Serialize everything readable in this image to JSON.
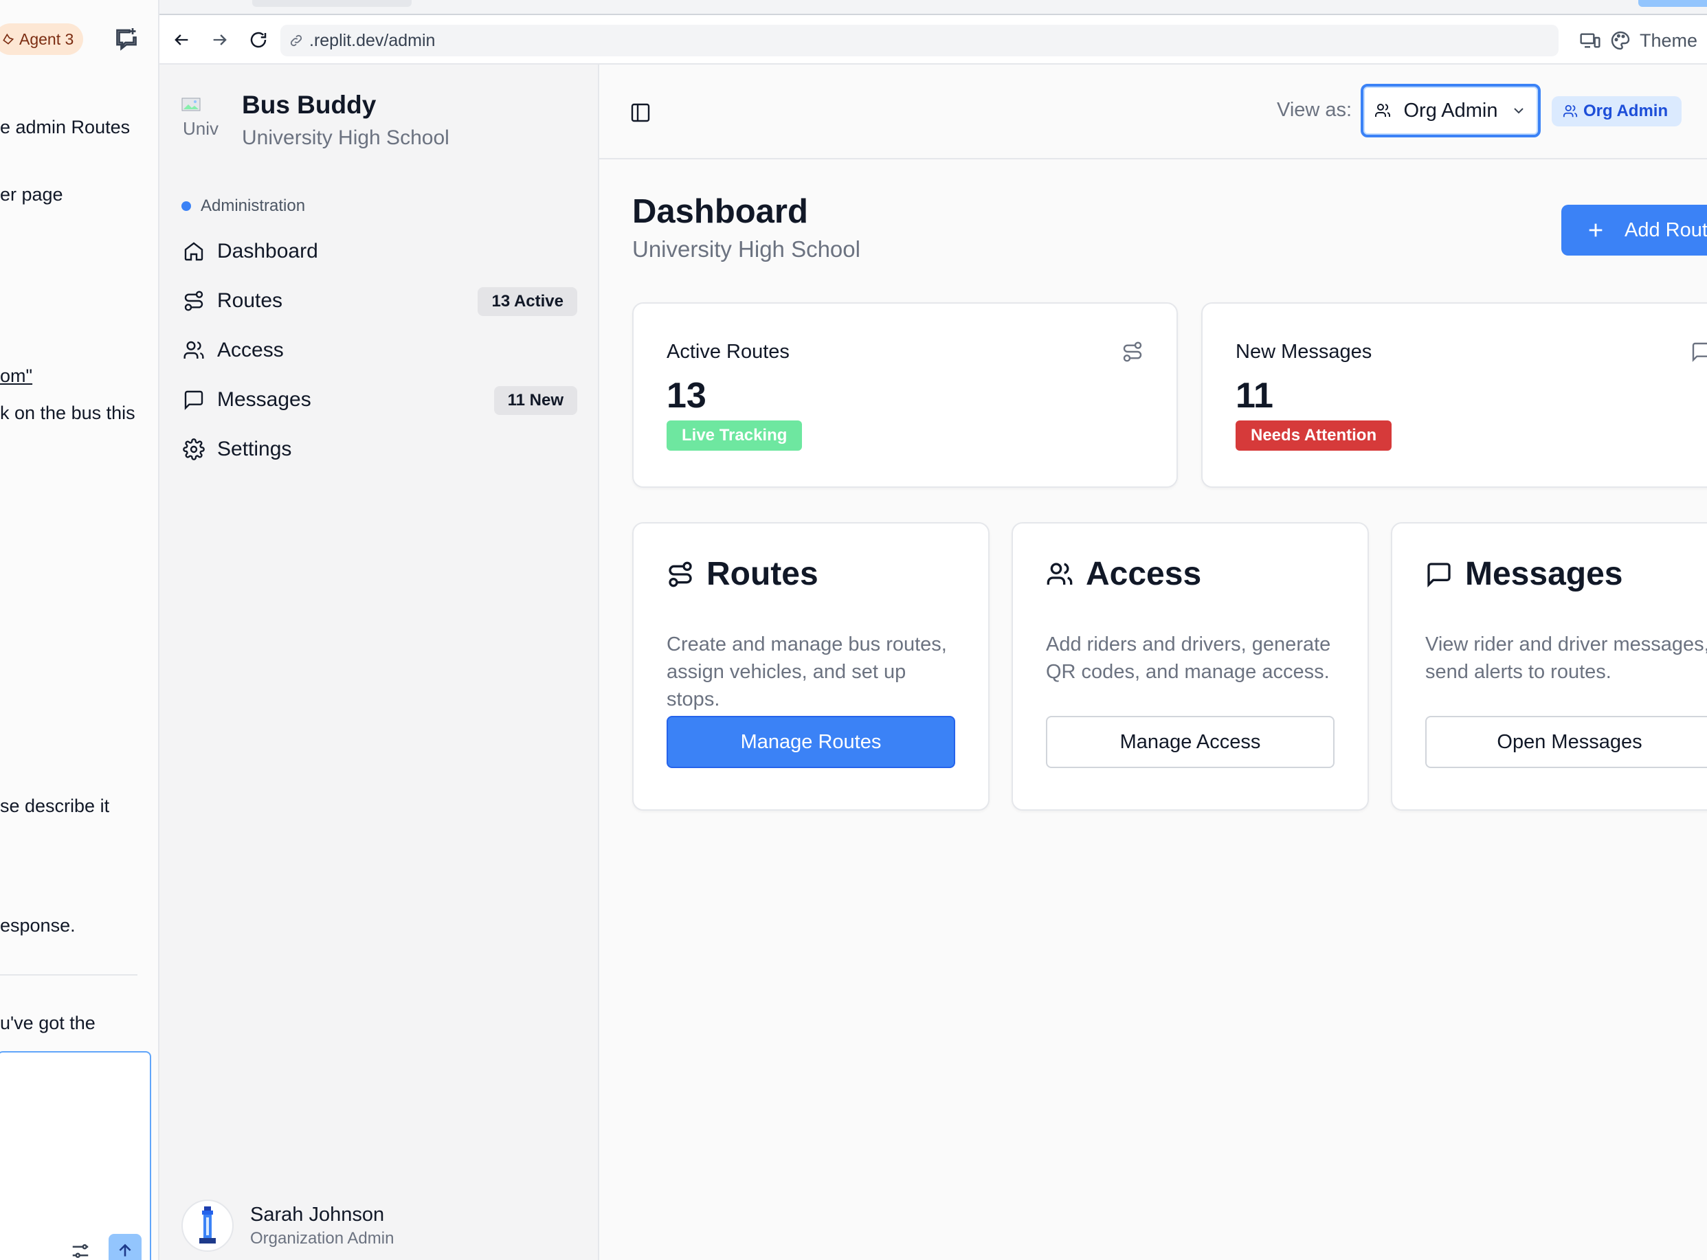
{
  "agent_panel": {
    "badge": "Agent 3",
    "chat_lines": [
      "e admin Routes",
      "er page",
      "om\"",
      "k on the bus this",
      "se describe it",
      "esponse.",
      "u've got the"
    ]
  },
  "browser": {
    "url": ".replit.dev/admin",
    "theme_label": "Theme"
  },
  "sidebar": {
    "app_title": "Bus Buddy",
    "app_subtitle": "University High School",
    "logo_alt": "Univ",
    "section_label": "Administration",
    "items": [
      {
        "label": "Dashboard",
        "icon": "home-icon"
      },
      {
        "label": "Routes",
        "icon": "route-icon",
        "badge": "13 Active"
      },
      {
        "label": "Access",
        "icon": "users-icon"
      },
      {
        "label": "Messages",
        "icon": "message-icon",
        "badge": "11 New"
      },
      {
        "label": "Settings",
        "icon": "gear-icon"
      }
    ],
    "user": {
      "name": "Sarah Johnson",
      "role": "Organization Admin"
    }
  },
  "header": {
    "view_as_label": "View as:",
    "view_as_value": "Org Admin",
    "role_badge": "Org Admin"
  },
  "page": {
    "title": "Dashboard",
    "subtitle": "University High School",
    "add_button": "Add Route"
  },
  "stats": [
    {
      "title": "Active Routes",
      "value": "13",
      "chip": "Live Tracking",
      "chip_color": "#6ee7a0",
      "icon": "route-icon"
    },
    {
      "title": "New Messages",
      "value": "11",
      "chip": "Needs Attention",
      "chip_color": "#d63a3a",
      "icon": "message-icon"
    }
  ],
  "features": [
    {
      "title": "Routes",
      "desc": "Create and manage bus routes, assign vehicles, and set up stops.",
      "button": "Manage Routes",
      "primary": true,
      "icon": "route-icon"
    },
    {
      "title": "Access",
      "desc": "Add riders and drivers, generate QR codes, and manage access.",
      "button": "Manage Access",
      "primary": false,
      "icon": "users-icon"
    },
    {
      "title": "Messages",
      "desc": "View rider and driver messages, send alerts to routes.",
      "button": "Open Messages",
      "primary": false,
      "icon": "message-icon"
    }
  ],
  "colors": {
    "accent": "#3b82f6",
    "live": "#6ee7a0",
    "alert": "#d63a3a"
  }
}
